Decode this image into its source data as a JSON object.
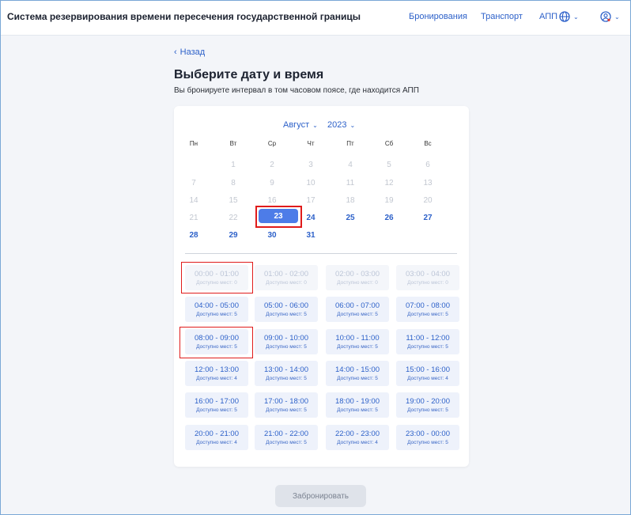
{
  "header": {
    "title": "Система резервирования времени пересечения государственной границы",
    "nav": [
      "Бронирования",
      "Транспорт",
      "АПП"
    ],
    "icons": [
      "globe-icon",
      "user-icon"
    ]
  },
  "back_label": "Назад",
  "page_title": "Выберите дату и время",
  "subtitle": "Вы бронируете интервал в том часовом поясе, где находится АПП",
  "calendar": {
    "month": "Август",
    "year": "2023",
    "weekdays": [
      "Пн",
      "Вт",
      "Ср",
      "Чт",
      "Пт",
      "Сб",
      "Вс"
    ],
    "weeks": [
      [
        "",
        "1",
        "2",
        "3",
        "4",
        "5",
        "6"
      ],
      [
        "7",
        "8",
        "9",
        "10",
        "11",
        "12",
        "13"
      ],
      [
        "14",
        "15",
        "16",
        "17",
        "18",
        "19",
        "20"
      ],
      [
        "21",
        "22",
        "23",
        "24",
        "25",
        "26",
        "27"
      ],
      [
        "28",
        "29",
        "30",
        "31",
        "",
        "",
        ""
      ]
    ],
    "selected": "23"
  },
  "slots": [
    {
      "time": "00:00 - 01:00",
      "avail": "Доступно мест: 0"
    },
    {
      "time": "01:00 - 02:00",
      "avail": "Доступно мест: 0"
    },
    {
      "time": "02:00 - 03:00",
      "avail": "Доступно мест: 0"
    },
    {
      "time": "03:00 - 04:00",
      "avail": "Доступно мест: 0"
    },
    {
      "time": "04:00 - 05:00",
      "avail": "Доступно мест: 5"
    },
    {
      "time": "05:00 - 06:00",
      "avail": "Доступно мест: 5"
    },
    {
      "time": "06:00 - 07:00",
      "avail": "Доступно мест: 5"
    },
    {
      "time": "07:00 - 08:00",
      "avail": "Доступно мест: 5"
    },
    {
      "time": "08:00 - 09:00",
      "avail": "Доступно мест: 5"
    },
    {
      "time": "09:00 - 10:00",
      "avail": "Доступно мест: 5"
    },
    {
      "time": "10:00 - 11:00",
      "avail": "Доступно мест: 5"
    },
    {
      "time": "11:00 - 12:00",
      "avail": "Доступно мест: 5"
    },
    {
      "time": "12:00 - 13:00",
      "avail": "Доступно мест: 4"
    },
    {
      "time": "13:00 - 14:00",
      "avail": "Доступно мест: 5"
    },
    {
      "time": "14:00 - 15:00",
      "avail": "Доступно мест: 5"
    },
    {
      "time": "15:00 - 16:00",
      "avail": "Доступно мест: 4"
    },
    {
      "time": "16:00 - 17:00",
      "avail": "Доступно мест: 5"
    },
    {
      "time": "17:00 - 18:00",
      "avail": "Доступно мест: 5"
    },
    {
      "time": "18:00 - 19:00",
      "avail": "Доступно мест: 5"
    },
    {
      "time": "19:00 - 20:00",
      "avail": "Доступно мест: 5"
    },
    {
      "time": "20:00 - 21:00",
      "avail": "Доступно мест: 4"
    },
    {
      "time": "21:00 - 22:00",
      "avail": "Доступно мест: 5"
    },
    {
      "time": "22:00 - 23:00",
      "avail": "Доступно мест: 4"
    },
    {
      "time": "23:00 - 00:00",
      "avail": "Доступно мест: 5"
    }
  ],
  "submit_label": "Забронировать",
  "colors": {
    "accent": "#2d61c9",
    "selected_day": "#4d7ce8",
    "highlight": "#e01b1b",
    "slot_bg": "#eef2fb"
  }
}
